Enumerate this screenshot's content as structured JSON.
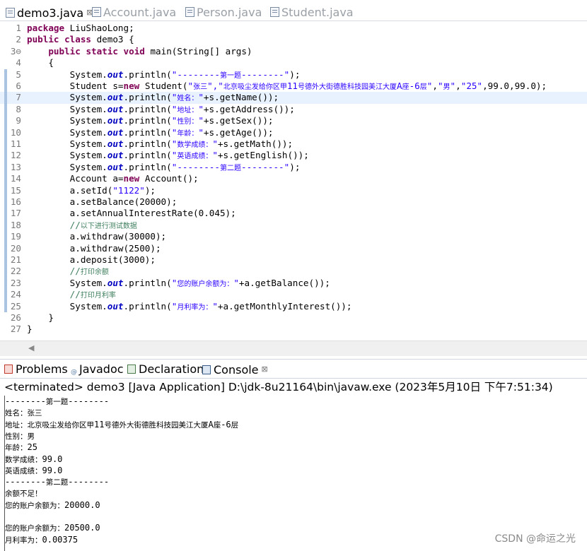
{
  "editor_tabs": [
    {
      "label": "demo3.java",
      "active": true,
      "close": "⊠"
    },
    {
      "label": "Account.java",
      "active": false
    },
    {
      "label": "Person.java",
      "active": false
    },
    {
      "label": "Student.java",
      "active": false
    }
  ],
  "code_lines": [
    {
      "n": "1",
      "segs": [
        {
          "t": "package",
          "c": "kw"
        },
        {
          "t": " LiuShaoLong;"
        }
      ]
    },
    {
      "n": "2",
      "segs": [
        {
          "t": "public",
          "c": "kw"
        },
        {
          "t": " "
        },
        {
          "t": "class",
          "c": "kw"
        },
        {
          "t": " demo3 {"
        }
      ]
    },
    {
      "n": "3⊖",
      "segs": [
        {
          "t": "    "
        },
        {
          "t": "public",
          "c": "kw"
        },
        {
          "t": " "
        },
        {
          "t": "static",
          "c": "kw"
        },
        {
          "t": " "
        },
        {
          "t": "void",
          "c": "kw"
        },
        {
          "t": " main(String[] args)"
        }
      ]
    },
    {
      "n": "4",
      "segs": [
        {
          "t": "    {"
        }
      ]
    },
    {
      "n": "5",
      "segs": [
        {
          "t": "        System."
        },
        {
          "t": "out",
          "c": "fld"
        },
        {
          "t": ".println("
        },
        {
          "t": "\"--------",
          "c": "str"
        },
        {
          "t": "第一题",
          "c": "str cn"
        },
        {
          "t": "--------\"",
          "c": "str"
        },
        {
          "t": ");"
        }
      ]
    },
    {
      "n": "6",
      "segs": [
        {
          "t": "        Student s="
        },
        {
          "t": "new",
          "c": "kw"
        },
        {
          "t": " Student("
        },
        {
          "t": "\"",
          "c": "str"
        },
        {
          "t": "张三",
          "c": "str cn"
        },
        {
          "t": "\",\"",
          "c": "str"
        },
        {
          "t": "北京吸尘发给你区甲",
          "c": "str cn"
        },
        {
          "t": "11",
          "c": "str"
        },
        {
          "t": "号德外大街德胜科技园美江大厦",
          "c": "str cn"
        },
        {
          "t": "A",
          "c": "str"
        },
        {
          "t": "座",
          "c": "str cn"
        },
        {
          "t": "-6",
          "c": "str"
        },
        {
          "t": "层",
          "c": "str cn"
        },
        {
          "t": "\"",
          "c": "str"
        },
        {
          "t": ","
        },
        {
          "t": "\"",
          "c": "str"
        },
        {
          "t": "男",
          "c": "str cn"
        },
        {
          "t": "\"",
          "c": "str"
        },
        {
          "t": ","
        },
        {
          "t": "\"25\"",
          "c": "str"
        },
        {
          "t": ",99.0,99.0);"
        }
      ]
    },
    {
      "n": "7",
      "cur": true,
      "segs": [
        {
          "t": "        System."
        },
        {
          "t": "out",
          "c": "fld"
        },
        {
          "t": ".println("
        },
        {
          "t": "\"",
          "c": "str"
        },
        {
          "t": "姓名：",
          "c": "str cn"
        },
        {
          "t": "\"",
          "c": "str"
        },
        {
          "t": "+s.getName());"
        }
      ]
    },
    {
      "n": "8",
      "segs": [
        {
          "t": "        System."
        },
        {
          "t": "out",
          "c": "fld"
        },
        {
          "t": ".println("
        },
        {
          "t": "\"",
          "c": "str"
        },
        {
          "t": "地址：",
          "c": "str cn"
        },
        {
          "t": "\"",
          "c": "str"
        },
        {
          "t": "+s.getAddress());"
        }
      ]
    },
    {
      "n": "9",
      "segs": [
        {
          "t": "        System."
        },
        {
          "t": "out",
          "c": "fld"
        },
        {
          "t": ".println("
        },
        {
          "t": "\"",
          "c": "str"
        },
        {
          "t": "性别：",
          "c": "str cn"
        },
        {
          "t": "\"",
          "c": "str"
        },
        {
          "t": "+s.getSex());"
        }
      ]
    },
    {
      "n": "10",
      "segs": [
        {
          "t": "        System."
        },
        {
          "t": "out",
          "c": "fld"
        },
        {
          "t": ".println("
        },
        {
          "t": "\"",
          "c": "str"
        },
        {
          "t": "年龄：",
          "c": "str cn"
        },
        {
          "t": "\"",
          "c": "str"
        },
        {
          "t": "+s.getAge());"
        }
      ]
    },
    {
      "n": "11",
      "segs": [
        {
          "t": "        System."
        },
        {
          "t": "out",
          "c": "fld"
        },
        {
          "t": ".println("
        },
        {
          "t": "\"",
          "c": "str"
        },
        {
          "t": "数学成绩：",
          "c": "str cn"
        },
        {
          "t": "\"",
          "c": "str"
        },
        {
          "t": "+s.getMath());"
        }
      ]
    },
    {
      "n": "12",
      "segs": [
        {
          "t": "        System."
        },
        {
          "t": "out",
          "c": "fld"
        },
        {
          "t": ".println("
        },
        {
          "t": "\"",
          "c": "str"
        },
        {
          "t": "英语成绩：",
          "c": "str cn"
        },
        {
          "t": "\"",
          "c": "str"
        },
        {
          "t": "+s.getEnglish());"
        }
      ]
    },
    {
      "n": "13",
      "segs": [
        {
          "t": "        System."
        },
        {
          "t": "out",
          "c": "fld"
        },
        {
          "t": ".println("
        },
        {
          "t": "\"--------",
          "c": "str"
        },
        {
          "t": "第二题",
          "c": "str cn"
        },
        {
          "t": "--------\"",
          "c": "str"
        },
        {
          "t": ");"
        }
      ]
    },
    {
      "n": "14",
      "segs": [
        {
          "t": "        Account a="
        },
        {
          "t": "new",
          "c": "kw"
        },
        {
          "t": " Account();"
        }
      ]
    },
    {
      "n": "15",
      "segs": [
        {
          "t": "        a.setId("
        },
        {
          "t": "\"1122\"",
          "c": "str"
        },
        {
          "t": ");"
        }
      ]
    },
    {
      "n": "16",
      "segs": [
        {
          "t": "        a.setBalance(20000);"
        }
      ]
    },
    {
      "n": "17",
      "segs": [
        {
          "t": "        a.setAnnualInterestRate(0.045);"
        }
      ]
    },
    {
      "n": "18",
      "segs": [
        {
          "t": "        "
        },
        {
          "t": "//",
          "c": "cmt"
        },
        {
          "t": "以下进行测试数据",
          "c": "cmt cn"
        }
      ]
    },
    {
      "n": "19",
      "segs": [
        {
          "t": "        a.withdraw(30000);"
        }
      ]
    },
    {
      "n": "20",
      "segs": [
        {
          "t": "        a.withdraw(2500);"
        }
      ]
    },
    {
      "n": "21",
      "segs": [
        {
          "t": "        a.deposit(3000);"
        }
      ]
    },
    {
      "n": "22",
      "segs": [
        {
          "t": "        "
        },
        {
          "t": "//",
          "c": "cmt"
        },
        {
          "t": "打印余额",
          "c": "cmt cn"
        }
      ]
    },
    {
      "n": "23",
      "segs": [
        {
          "t": "        System."
        },
        {
          "t": "out",
          "c": "fld"
        },
        {
          "t": ".println("
        },
        {
          "t": "\"",
          "c": "str"
        },
        {
          "t": "您的账户余额为：",
          "c": "str cn"
        },
        {
          "t": "\"",
          "c": "str"
        },
        {
          "t": "+a.getBalance());"
        }
      ]
    },
    {
      "n": "24",
      "segs": [
        {
          "t": "        "
        },
        {
          "t": "//",
          "c": "cmt"
        },
        {
          "t": "打印月利率",
          "c": "cmt cn"
        }
      ]
    },
    {
      "n": "25",
      "segs": [
        {
          "t": "        System."
        },
        {
          "t": "out",
          "c": "fld"
        },
        {
          "t": ".println("
        },
        {
          "t": "\"",
          "c": "str"
        },
        {
          "t": "月利率为：",
          "c": "str cn"
        },
        {
          "t": "\"",
          "c": "str"
        },
        {
          "t": "+a.getMonthlyInterest());"
        }
      ]
    },
    {
      "n": "26",
      "segs": [
        {
          "t": "    }"
        }
      ]
    },
    {
      "n": "27",
      "segs": [
        {
          "t": "}"
        }
      ]
    }
  ],
  "view_tabs": [
    {
      "label": "Problems",
      "icon": "problems-icon",
      "color": "#c0392b"
    },
    {
      "label": "Javadoc",
      "icon": "javadoc-icon",
      "color": "#5b7fa8"
    },
    {
      "label": "Declaration",
      "icon": "declaration-icon",
      "color": "#4a7a4a"
    },
    {
      "label": "Console",
      "icon": "console-icon",
      "color": "#3b5f8a",
      "active": true,
      "close": "⊠"
    }
  ],
  "console": {
    "header": "<terminated> demo3 [Java Application] D:\\jdk-8u21164\\bin\\javaw.exe  (2023年5月10日 下午7:51:34)",
    "lines": [
      "--------第一题--------",
      "姓名：张三",
      "地址：北京吸尘发给你区甲11号德外大街德胜科技园美江大厦A座-6层",
      "性别：男",
      "年龄：25",
      "数学成绩：99.0",
      "英语成绩：99.0",
      "--------第二题--------",
      "余额不足！",
      "您的账户余额为：20000.0",
      "",
      "您的账户余额为：20500.0",
      "月利率为：0.00375"
    ]
  },
  "watermark": "CSDN @命运之光"
}
